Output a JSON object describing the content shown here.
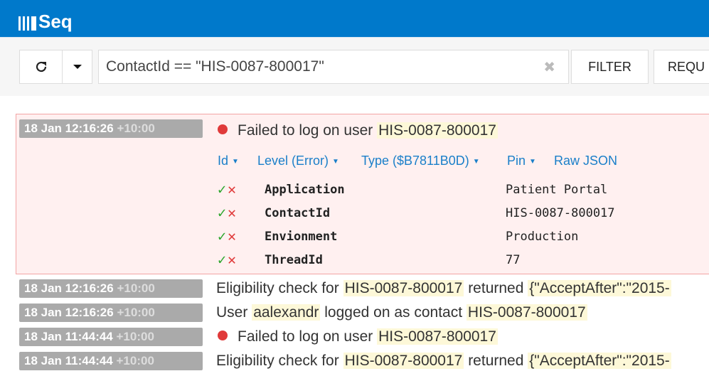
{
  "app": {
    "name": "Seq"
  },
  "toolbar": {
    "refresh_icon": "refresh-icon",
    "dropdown_icon": "caret-down-icon",
    "query": "ContactId == \"HIS-0087-800017\"",
    "clear_icon": "close-icon",
    "filter_label": "FILTER",
    "request_label": "REQU"
  },
  "expanded": {
    "timestamp": "18 Jan 12:16:26",
    "tz": "+10:00",
    "level_color": "#e03a3a",
    "message_prefix": "Failed to log on user",
    "message_token": "HIS-0087-800017",
    "menu": [
      "Id",
      "Level (Error)",
      "Type ($B7811B0D)",
      "Pin",
      "Raw JSON"
    ],
    "properties": [
      {
        "key": "Application",
        "value": "Patient Portal"
      },
      {
        "key": "ContactId",
        "value": "HIS-0087-800017"
      },
      {
        "key": "Envionment",
        "value": "Production"
      },
      {
        "key": "ThreadId",
        "value": "77"
      }
    ]
  },
  "events": [
    {
      "timestamp": "18 Jan 12:16:26",
      "tz": "+10:00",
      "parts": [
        {
          "t": "Eligibility check for "
        },
        {
          "t": "HIS-0087-800017",
          "h": 1
        },
        {
          "t": " returned "
        },
        {
          "t": "{\"AcceptAfter\":\"2015-",
          "h": 1
        }
      ]
    },
    {
      "timestamp": "18 Jan 12:16:26",
      "tz": "+10:00",
      "parts": [
        {
          "t": "User "
        },
        {
          "t": "aalexandr",
          "h": 1
        },
        {
          "t": " logged on as contact "
        },
        {
          "t": "HIS-0087-800017",
          "h": 1
        }
      ]
    },
    {
      "timestamp": "18 Jan 11:44:44",
      "tz": "+10:00",
      "error": true,
      "parts": [
        {
          "t": "Failed to log on user "
        },
        {
          "t": "HIS-0087-800017",
          "h": 1
        }
      ]
    },
    {
      "timestamp": "18 Jan 11:44:44",
      "tz": "+10:00",
      "parts": [
        {
          "t": "Eligibility check for "
        },
        {
          "t": "HIS-0087-800017",
          "h": 1
        },
        {
          "t": " returned "
        },
        {
          "t": "{\"AcceptAfter\":\"2015-",
          "h": 1
        }
      ]
    }
  ]
}
